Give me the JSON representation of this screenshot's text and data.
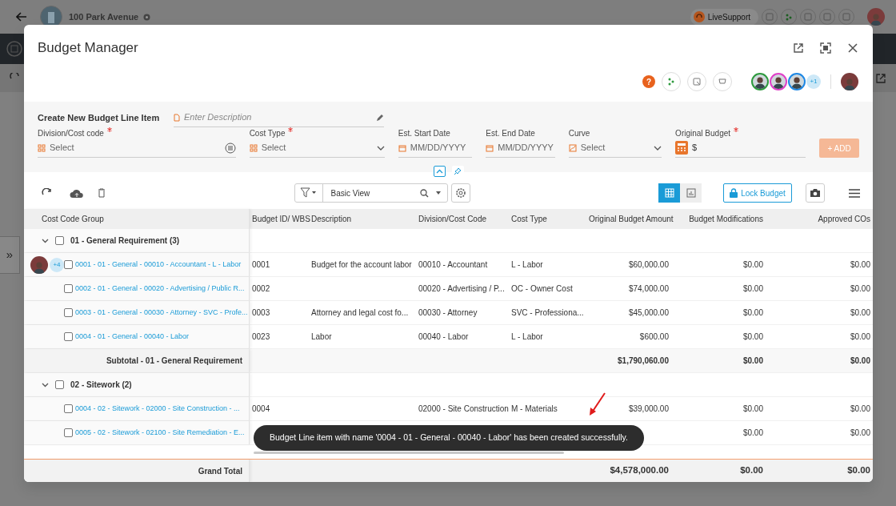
{
  "background_app": {
    "project": "100 Park Avenue",
    "support": "LiveSupport",
    "side_toggle": "»"
  },
  "modal": {
    "title": "Budget Manager",
    "help": "?",
    "collaborators": [
      {
        "color": "#2e9a3e"
      },
      {
        "color": "#e040c8"
      },
      {
        "color": "#1e88e5"
      }
    ],
    "more_collaborators": "+1"
  },
  "form": {
    "title": "Create New Budget Line Item",
    "description_placeholder": "Enter Description",
    "fields": [
      {
        "kind": "select-list",
        "label": "Division/Cost code",
        "required": true,
        "placeholder": "Select"
      },
      {
        "kind": "select",
        "label": "Cost Type",
        "required": true,
        "placeholder": "Select"
      },
      {
        "kind": "date",
        "label": "Est. Start Date",
        "required": false,
        "placeholder": "MM/DD/YYYY"
      },
      {
        "kind": "date",
        "label": "Est. End Date",
        "required": false,
        "placeholder": "MM/DD/YYYY"
      },
      {
        "kind": "curve",
        "label": "Curve",
        "required": false,
        "placeholder": "Select"
      },
      {
        "kind": "money",
        "label": "Original Budget",
        "required": true,
        "prefix": "$"
      }
    ],
    "add_button": "+ ADD"
  },
  "toolbar": {
    "view": "Basic View",
    "view_modes": [
      {
        "kind": "grid",
        "selected": true
      },
      {
        "kind": "chart",
        "selected": false
      }
    ],
    "lock_button": "Lock Budget"
  },
  "table": {
    "columns": [
      "Cost Code Group",
      "Budget ID/ WBS",
      "Description",
      "Division/Cost Code",
      "Cost Type",
      "Original Budget Amount",
      "Budget Modifications",
      "Approved COs"
    ],
    "groups": [
      {
        "title": "01 - General Requirement (3)",
        "expanded": true,
        "checked": false,
        "rows": [
          {
            "name": "0001 - 01 - General - 00010 - Accountant - L - Labor",
            "viewers": "+4",
            "checked": false,
            "cells": [
              "0001",
              "Budget for the account labor",
              "00010 - Accountant",
              "L - Labor",
              "$60,000.00",
              "$0.00",
              "$0.00"
            ]
          },
          {
            "name": "0002 - 01 - General - 00020 - Advertising / Public R...",
            "checked": false,
            "cells": [
              "0002",
              null,
              "00020 - Advertising / P...",
              "OC - Owner Cost",
              "$74,000.00",
              "$0.00",
              "$0.00"
            ]
          },
          {
            "name": "0003 - 01 - General - 00030 - Attorney - SVC - Profe...",
            "checked": false,
            "cells": [
              "0003",
              "Attorney and legal cost fo...",
              "00030 - Attorney",
              "SVC - Professiona...",
              "$45,000.00",
              "$0.00",
              "$0.00"
            ]
          },
          {
            "name": "0004 - 01 - General - 00040 - Labor",
            "checked": false,
            "cells": [
              "0023",
              "Labor",
              "00040 - Labor",
              "L - Labor",
              "$600.00",
              "$0.00",
              "$0.00"
            ]
          }
        ],
        "subtotal": {
          "label": "Subtotal - 01 - General Requirement",
          "cells": [
            "$1,790,060.00",
            "$0.00",
            "$0.00"
          ]
        }
      },
      {
        "title": "02 - Sitework (2)",
        "expanded": true,
        "checked": false,
        "rows": [
          {
            "name": "0004 - 02 - Sitework - 02000 - Site Construction - ...",
            "checked": false,
            "cells": [
              "0004",
              null,
              "02000 - Site Construction",
              "M - Materials",
              "$39,000.00",
              "$0.00",
              "$0.00"
            ]
          },
          {
            "name": "0005 - 02 - Sitework - 02100 - Site Remediation - E...",
            "checked": false,
            "cells": [
              null,
              null,
              null,
              null,
              null,
              "$0.00",
              "$0.00"
            ]
          }
        ]
      }
    ],
    "grand_total": {
      "label": "Grand Total",
      "cells": [
        "$4,578,000.00",
        "$0.00",
        "$0.00"
      ]
    }
  },
  "toast": "Budget Line item with name '0004 - 01 - General - 00040 - Labor' has been created successfully."
}
